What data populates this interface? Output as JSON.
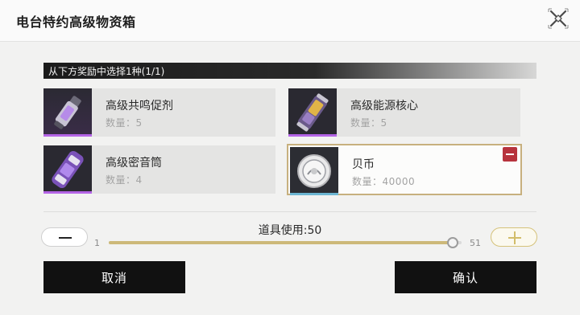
{
  "dialog": {
    "title": "电台特约高级物资箱",
    "close_icon": "close-x-icon"
  },
  "section": {
    "label": "从下方奖励中选择1种(1/1)"
  },
  "items": [
    {
      "name": "高级共鸣促剂",
      "qty": "数量：5",
      "icon": "vial-icon",
      "rarity_color": "#b464e6",
      "selected": false
    },
    {
      "name": "高级能源核心",
      "qty": "数量：5",
      "icon": "energy-cell-icon",
      "rarity_color": "#b464e6",
      "selected": false
    },
    {
      "name": "高级密音筒",
      "qty": "数量：4",
      "icon": "sound-tube-icon",
      "rarity_color": "#b464e6",
      "selected": false
    },
    {
      "name": "贝币",
      "qty": "数量：40000",
      "icon": "coin-icon",
      "rarity_color": "#6cb6d2",
      "selected": true
    }
  ],
  "slider": {
    "label": "道具使用:50",
    "min_label": "1",
    "max_label": "51",
    "value": 50,
    "min": 1,
    "max": 51
  },
  "buttons": {
    "cancel": "取消",
    "confirm": "确认"
  },
  "colors": {
    "accent_gold": "#cdb979",
    "remove_red": "#b7333d"
  }
}
